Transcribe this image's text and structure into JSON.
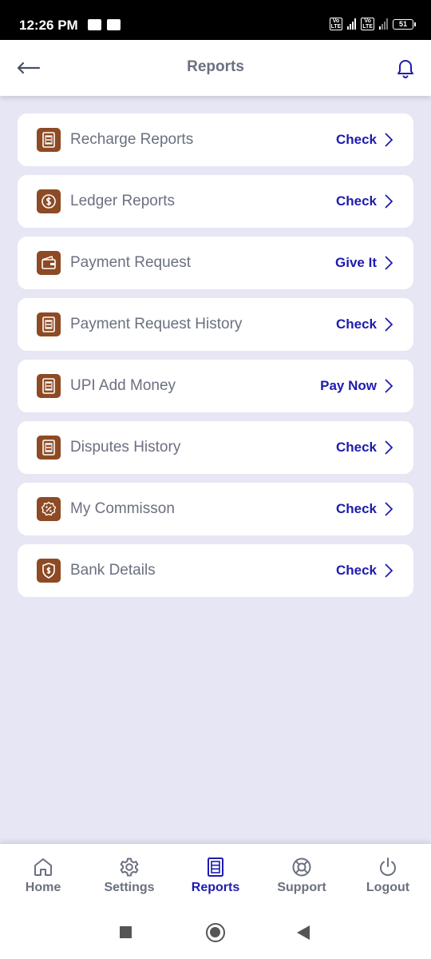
{
  "status_bar": {
    "time": "12:26 PM",
    "battery": "51"
  },
  "header": {
    "title": "Reports"
  },
  "items": [
    {
      "label": "Recharge Reports",
      "action": "Check",
      "icon": "document-icon"
    },
    {
      "label": "Ledger Reports",
      "action": "Check",
      "icon": "dollar-exchange-icon"
    },
    {
      "label": "Payment Request",
      "action": "Give It",
      "icon": "wallet-icon"
    },
    {
      "label": "Payment Request History",
      "action": "Check",
      "icon": "document-icon"
    },
    {
      "label": "UPI Add Money",
      "action": "Pay Now",
      "icon": "document-icon"
    },
    {
      "label": "Disputes History",
      "action": "Check",
      "icon": "document-icon"
    },
    {
      "label": "My Commisson",
      "action": "Check",
      "icon": "percent-badge-icon"
    },
    {
      "label": "Bank Details",
      "action": "Check",
      "icon": "shield-dollar-icon"
    }
  ],
  "bottom_nav": [
    {
      "label": "Home",
      "icon": "home-icon",
      "active": false
    },
    {
      "label": "Settings",
      "icon": "gear-icon",
      "active": false
    },
    {
      "label": "Reports",
      "icon": "report-icon",
      "active": true
    },
    {
      "label": "Support",
      "icon": "lifebuoy-icon",
      "active": false
    },
    {
      "label": "Logout",
      "icon": "power-icon",
      "active": false
    }
  ],
  "colors": {
    "accent": "#1d1cad",
    "icon_bg": "#8d4a24",
    "background": "#e6e6f5",
    "text_muted": "#6b7080"
  }
}
